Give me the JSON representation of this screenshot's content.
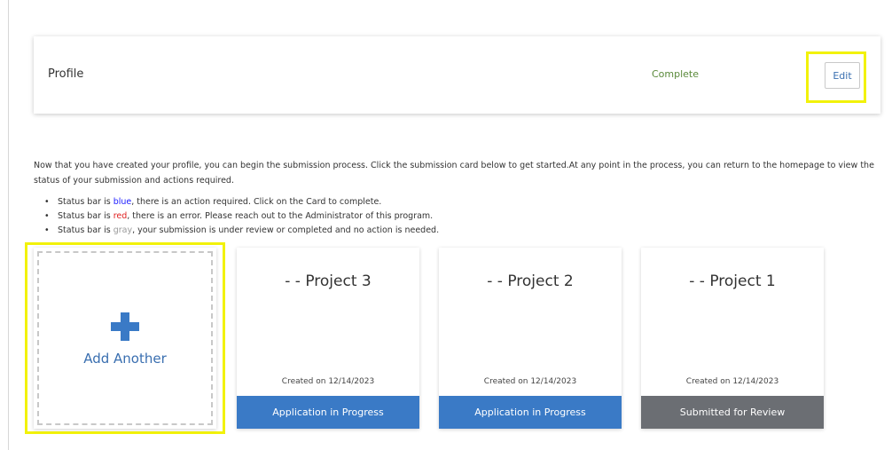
{
  "profile": {
    "title": "Profile",
    "status": "Complete",
    "edit_label": "Edit"
  },
  "intro": {
    "text": "Now that you have created your profile, you can begin the submission process. Click the submission card below to get started.At any point in the process, you can return to the homepage to view the status of your submission and actions required."
  },
  "bullets": [
    {
      "prefix": "Status bar is ",
      "color_word": "blue",
      "suffix": ", there is an action required. Click on the Card to complete."
    },
    {
      "prefix": "Status bar is ",
      "color_word": "red",
      "suffix": ", there is an error. Please reach out to the Administrator of this program."
    },
    {
      "prefix": "Status bar is ",
      "color_word": "gray",
      "suffix": ", your submission is under review or completed and no action is needed."
    }
  ],
  "add_card": {
    "icon": "plus-icon",
    "label": "Add Another"
  },
  "projects": [
    {
      "title": "- - Project 3",
      "created": "Created on 12/14/2023",
      "status": "Application in Progress",
      "status_color": "#3a7ac6"
    },
    {
      "title": "- - Project 2",
      "created": "Created on 12/14/2023",
      "status": "Application in Progress",
      "status_color": "#3a7ac6"
    },
    {
      "title": "- - Project 1",
      "created": "Created on 12/14/2023",
      "status": "Submitted for Review",
      "status_color": "#6b6e73"
    }
  ],
  "colors": {
    "accent_blue": "#3a7ac6",
    "highlight_yellow": "#f2f20a",
    "complete_green": "#5a8a3a",
    "submitted_gray": "#6b6e73"
  }
}
